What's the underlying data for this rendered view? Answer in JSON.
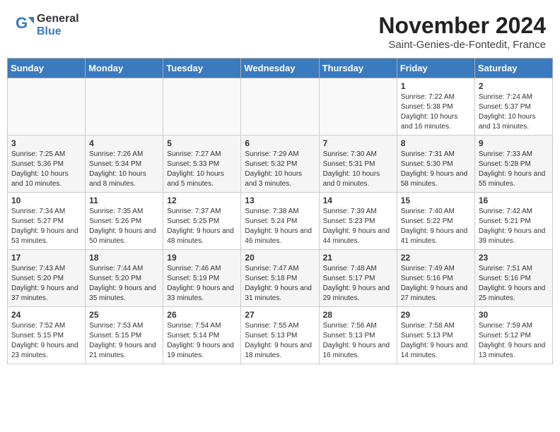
{
  "logo": {
    "general": "General",
    "blue": "Blue"
  },
  "title": "November 2024",
  "subtitle": "Saint-Genies-de-Fontedit, France",
  "weekdays": [
    "Sunday",
    "Monday",
    "Tuesday",
    "Wednesday",
    "Thursday",
    "Friday",
    "Saturday"
  ],
  "weeks": [
    [
      {
        "day": "",
        "info": ""
      },
      {
        "day": "",
        "info": ""
      },
      {
        "day": "",
        "info": ""
      },
      {
        "day": "",
        "info": ""
      },
      {
        "day": "",
        "info": ""
      },
      {
        "day": "1",
        "info": "Sunrise: 7:22 AM\nSunset: 5:38 PM\nDaylight: 10 hours and 16 minutes."
      },
      {
        "day": "2",
        "info": "Sunrise: 7:24 AM\nSunset: 5:37 PM\nDaylight: 10 hours and 13 minutes."
      }
    ],
    [
      {
        "day": "3",
        "info": "Sunrise: 7:25 AM\nSunset: 5:36 PM\nDaylight: 10 hours and 10 minutes."
      },
      {
        "day": "4",
        "info": "Sunrise: 7:26 AM\nSunset: 5:34 PM\nDaylight: 10 hours and 8 minutes."
      },
      {
        "day": "5",
        "info": "Sunrise: 7:27 AM\nSunset: 5:33 PM\nDaylight: 10 hours and 5 minutes."
      },
      {
        "day": "6",
        "info": "Sunrise: 7:29 AM\nSunset: 5:32 PM\nDaylight: 10 hours and 3 minutes."
      },
      {
        "day": "7",
        "info": "Sunrise: 7:30 AM\nSunset: 5:31 PM\nDaylight: 10 hours and 0 minutes."
      },
      {
        "day": "8",
        "info": "Sunrise: 7:31 AM\nSunset: 5:30 PM\nDaylight: 9 hours and 58 minutes."
      },
      {
        "day": "9",
        "info": "Sunrise: 7:33 AM\nSunset: 5:28 PM\nDaylight: 9 hours and 55 minutes."
      }
    ],
    [
      {
        "day": "10",
        "info": "Sunrise: 7:34 AM\nSunset: 5:27 PM\nDaylight: 9 hours and 53 minutes."
      },
      {
        "day": "11",
        "info": "Sunrise: 7:35 AM\nSunset: 5:26 PM\nDaylight: 9 hours and 50 minutes."
      },
      {
        "day": "12",
        "info": "Sunrise: 7:37 AM\nSunset: 5:25 PM\nDaylight: 9 hours and 48 minutes."
      },
      {
        "day": "13",
        "info": "Sunrise: 7:38 AM\nSunset: 5:24 PM\nDaylight: 9 hours and 46 minutes."
      },
      {
        "day": "14",
        "info": "Sunrise: 7:39 AM\nSunset: 5:23 PM\nDaylight: 9 hours and 44 minutes."
      },
      {
        "day": "15",
        "info": "Sunrise: 7:40 AM\nSunset: 5:22 PM\nDaylight: 9 hours and 41 minutes."
      },
      {
        "day": "16",
        "info": "Sunrise: 7:42 AM\nSunset: 5:21 PM\nDaylight: 9 hours and 39 minutes."
      }
    ],
    [
      {
        "day": "17",
        "info": "Sunrise: 7:43 AM\nSunset: 5:20 PM\nDaylight: 9 hours and 37 minutes."
      },
      {
        "day": "18",
        "info": "Sunrise: 7:44 AM\nSunset: 5:20 PM\nDaylight: 9 hours and 35 minutes."
      },
      {
        "day": "19",
        "info": "Sunrise: 7:46 AM\nSunset: 5:19 PM\nDaylight: 9 hours and 33 minutes."
      },
      {
        "day": "20",
        "info": "Sunrise: 7:47 AM\nSunset: 5:18 PM\nDaylight: 9 hours and 31 minutes."
      },
      {
        "day": "21",
        "info": "Sunrise: 7:48 AM\nSunset: 5:17 PM\nDaylight: 9 hours and 29 minutes."
      },
      {
        "day": "22",
        "info": "Sunrise: 7:49 AM\nSunset: 5:16 PM\nDaylight: 9 hours and 27 minutes."
      },
      {
        "day": "23",
        "info": "Sunrise: 7:51 AM\nSunset: 5:16 PM\nDaylight: 9 hours and 25 minutes."
      }
    ],
    [
      {
        "day": "24",
        "info": "Sunrise: 7:52 AM\nSunset: 5:15 PM\nDaylight: 9 hours and 23 minutes."
      },
      {
        "day": "25",
        "info": "Sunrise: 7:53 AM\nSunset: 5:15 PM\nDaylight: 9 hours and 21 minutes."
      },
      {
        "day": "26",
        "info": "Sunrise: 7:54 AM\nSunset: 5:14 PM\nDaylight: 9 hours and 19 minutes."
      },
      {
        "day": "27",
        "info": "Sunrise: 7:55 AM\nSunset: 5:13 PM\nDaylight: 9 hours and 18 minutes."
      },
      {
        "day": "28",
        "info": "Sunrise: 7:56 AM\nSunset: 5:13 PM\nDaylight: 9 hours and 16 minutes."
      },
      {
        "day": "29",
        "info": "Sunrise: 7:58 AM\nSunset: 5:13 PM\nDaylight: 9 hours and 14 minutes."
      },
      {
        "day": "30",
        "info": "Sunrise: 7:59 AM\nSunset: 5:12 PM\nDaylight: 9 hours and 13 minutes."
      }
    ]
  ]
}
